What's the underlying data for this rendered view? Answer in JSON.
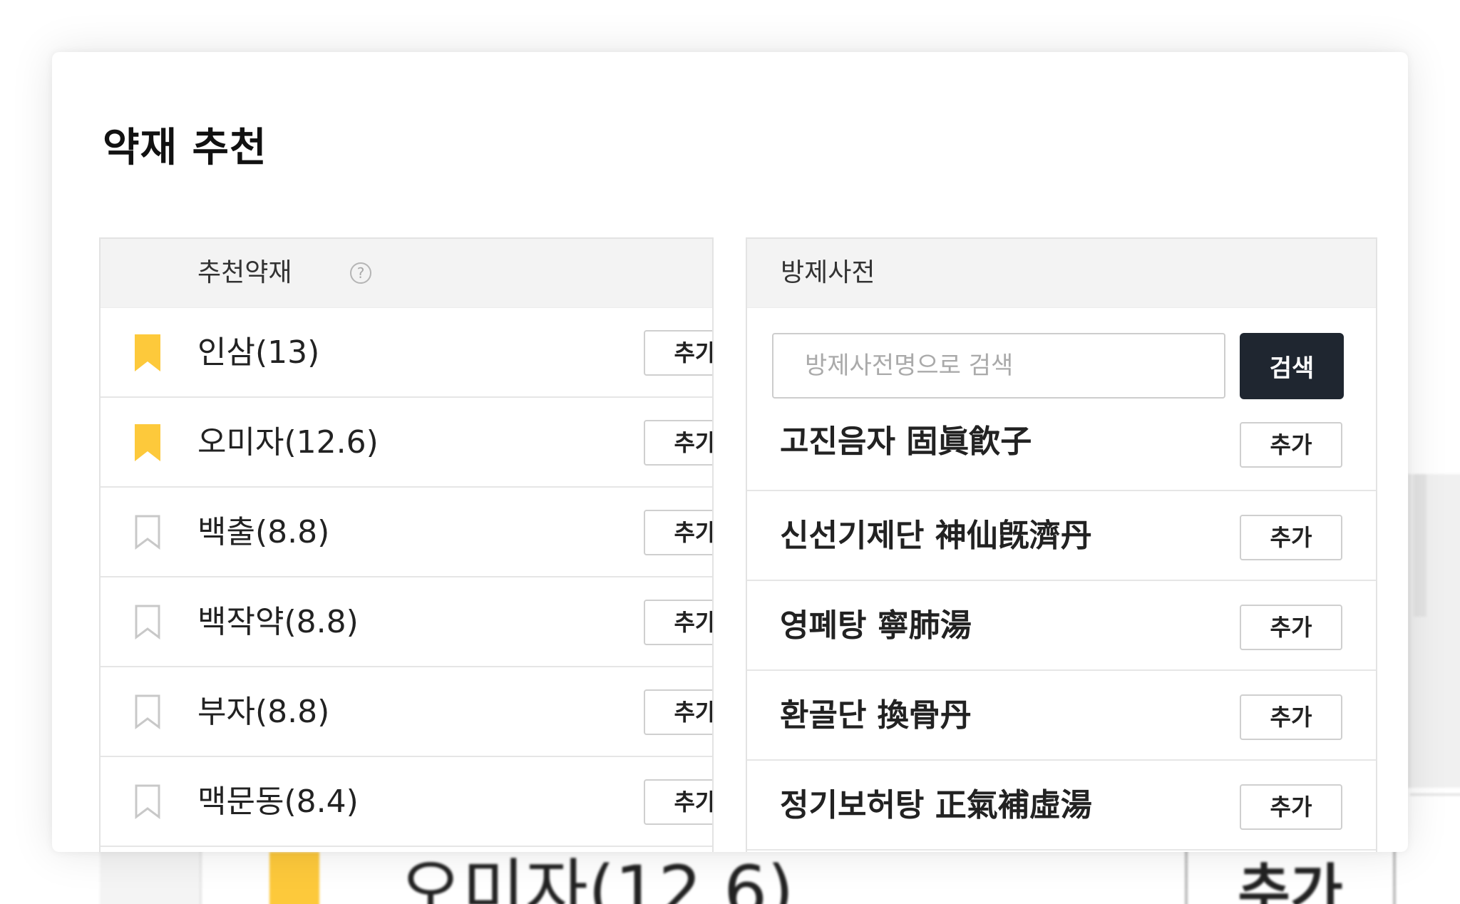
{
  "background": {
    "row_name": "오미자(12.6)",
    "row_add_label": "추가",
    "colors": {
      "bookmark": "#fdc93b"
    }
  },
  "modal": {
    "title": "약재 추천",
    "left_panel": {
      "header": "추천약재",
      "help_icon_glyph": "?",
      "add_label": "추가",
      "items": [
        {
          "name": "인삼(13)",
          "bookmarked": true
        },
        {
          "name": "오미자(12.6)",
          "bookmarked": true
        },
        {
          "name": "백출(8.8)",
          "bookmarked": false
        },
        {
          "name": "백작약(8.8)",
          "bookmarked": false
        },
        {
          "name": "부자(8.8)",
          "bookmarked": false
        },
        {
          "name": "맥문동(8.4)",
          "bookmarked": false
        }
      ]
    },
    "right_panel": {
      "header": "방제사전",
      "search_placeholder": "방제사전명으로 검색",
      "search_button": "검색",
      "add_label": "추가",
      "items": [
        {
          "name": "고진음자 固眞飮子"
        },
        {
          "name": "신선기제단 神仙旣濟丹"
        },
        {
          "name": "영폐탕 寧肺湯"
        },
        {
          "name": "환골단 換骨丹"
        },
        {
          "name": "정기보허탕 正氣補虛湯"
        }
      ]
    },
    "colors": {
      "bookmark_filled": "#fdc93b",
      "bookmark_outline": "#c8c8c8",
      "search_button_bg": "#1f2630",
      "header_bg": "#f3f3f3"
    }
  }
}
